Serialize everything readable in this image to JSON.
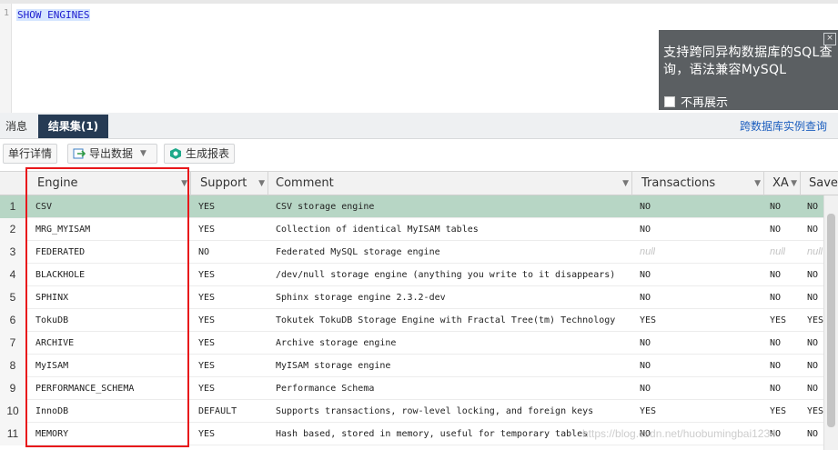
{
  "editor": {
    "line_numbers": [
      "1"
    ],
    "sql": "SHOW ENGINES"
  },
  "popup": {
    "text": "支持跨同异构数据库的SQL查询，语法兼容MySQL",
    "checkbox_label": "不再展示",
    "close_glyph": "×"
  },
  "tabs": {
    "messages": "消息",
    "results": "结果集(1)"
  },
  "cross_db_link": "跨数据库实例查询",
  "toolbar": {
    "detail": "单行详情",
    "export": "导出数据",
    "report": "生成报表"
  },
  "grid": {
    "columns": [
      "Engine",
      "Support",
      "Comment",
      "Transactions",
      "XA",
      "Savep"
    ],
    "null_text": "null",
    "rows": [
      {
        "n": "1",
        "engine": "CSV",
        "support": "YES",
        "comment": "CSV storage engine",
        "transactions": "NO",
        "xa": "NO",
        "savepoints": "NO"
      },
      {
        "n": "2",
        "engine": "MRG_MYISAM",
        "support": "YES",
        "comment": "Collection of identical MyISAM tables",
        "transactions": "NO",
        "xa": "NO",
        "savepoints": "NO"
      },
      {
        "n": "3",
        "engine": "FEDERATED",
        "support": "NO",
        "comment": "Federated MySQL storage engine",
        "transactions": "null",
        "xa": "null",
        "savepoints": "null"
      },
      {
        "n": "4",
        "engine": "BLACKHOLE",
        "support": "YES",
        "comment": "/dev/null storage engine (anything you write to it disappears)",
        "transactions": "NO",
        "xa": "NO",
        "savepoints": "NO"
      },
      {
        "n": "5",
        "engine": "SPHINX",
        "support": "YES",
        "comment": "Sphinx storage engine 2.3.2-dev",
        "transactions": "NO",
        "xa": "NO",
        "savepoints": "NO"
      },
      {
        "n": "6",
        "engine": "TokuDB",
        "support": "YES",
        "comment": "Tokutek TokuDB Storage Engine with Fractal Tree(tm) Technology",
        "transactions": "YES",
        "xa": "YES",
        "savepoints": "YES"
      },
      {
        "n": "7",
        "engine": "ARCHIVE",
        "support": "YES",
        "comment": "Archive storage engine",
        "transactions": "NO",
        "xa": "NO",
        "savepoints": "NO"
      },
      {
        "n": "8",
        "engine": "MyISAM",
        "support": "YES",
        "comment": "MyISAM storage engine",
        "transactions": "NO",
        "xa": "NO",
        "savepoints": "NO"
      },
      {
        "n": "9",
        "engine": "PERFORMANCE_SCHEMA",
        "support": "YES",
        "comment": "Performance Schema",
        "transactions": "NO",
        "xa": "NO",
        "savepoints": "NO"
      },
      {
        "n": "10",
        "engine": "InnoDB",
        "support": "DEFAULT",
        "comment": "Supports transactions, row-level locking, and foreign keys",
        "transactions": "YES",
        "xa": "YES",
        "savepoints": "YES"
      },
      {
        "n": "11",
        "engine": "MEMORY",
        "support": "YES",
        "comment": "Hash based, stored in memory, useful for temporary tables",
        "transactions": "NO",
        "xa": "NO",
        "savepoints": "NO"
      }
    ]
  },
  "watermark": "https://blog.csdn.net/huobumingbai1234",
  "colors": {
    "highlight": "#e8171b",
    "selected_row": "#b7d6c5",
    "active_tab": "#263b54",
    "link": "#1d5fbf"
  }
}
